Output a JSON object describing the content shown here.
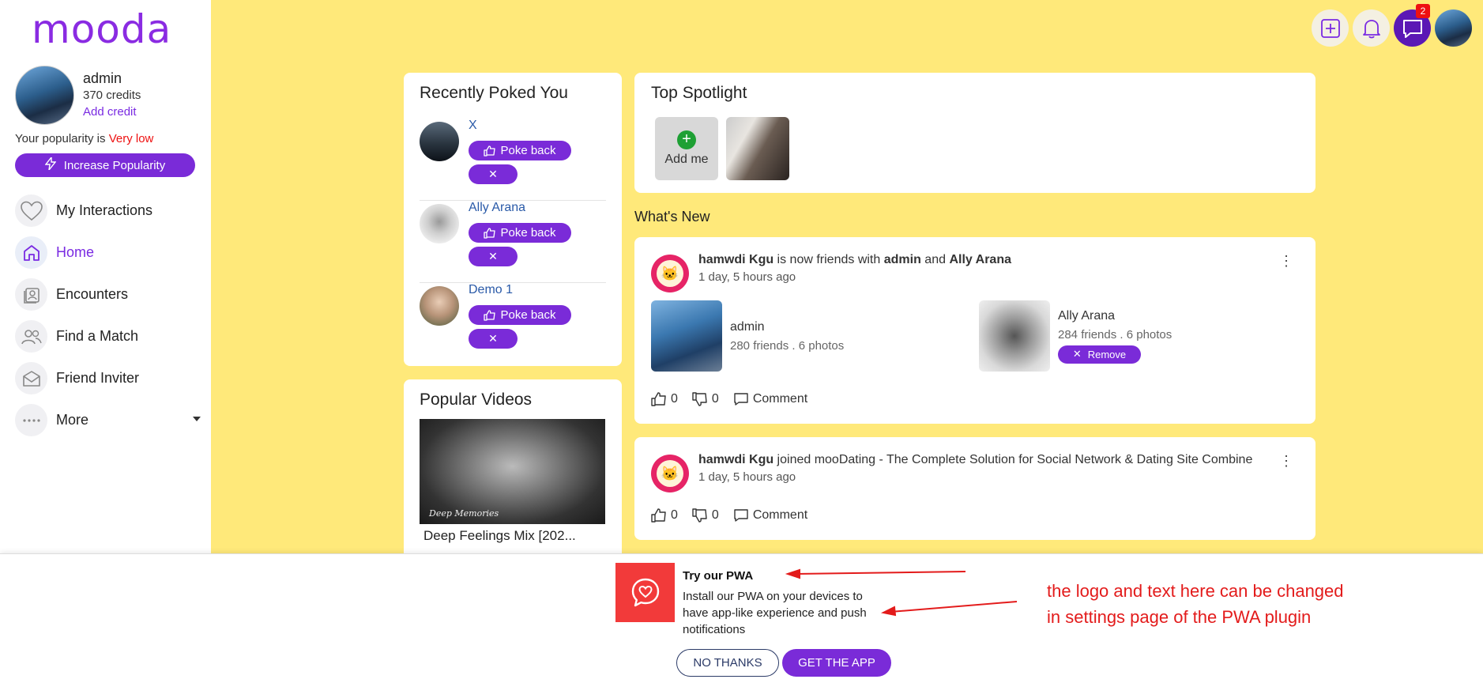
{
  "app": {
    "logo": "mooda"
  },
  "profile": {
    "name": "admin",
    "credits": "370 credits",
    "add_credit": "Add credit",
    "popularity_prefix": "Your popularity is ",
    "popularity_level": "Very low",
    "increase_button": "Increase Popularity"
  },
  "nav": {
    "items": [
      {
        "label": "My Interactions",
        "icon": "heart-icon"
      },
      {
        "label": "Home",
        "icon": "home-icon"
      },
      {
        "label": "Encounters",
        "icon": "encounters-icon"
      },
      {
        "label": "Find a Match",
        "icon": "users-icon"
      },
      {
        "label": "Friend Inviter",
        "icon": "mail-icon"
      },
      {
        "label": "More",
        "icon": "more-icon"
      }
    ]
  },
  "topbar": {
    "notification_count": "2"
  },
  "poked": {
    "title": "Recently Poked You",
    "poke_back_label": "Poke back",
    "items": [
      {
        "name": "X"
      },
      {
        "name": "Ally Arana"
      },
      {
        "name": "Demo 1"
      }
    ]
  },
  "videos": {
    "title": "Popular Videos",
    "video_title": "Deep Feelings Mix [202...",
    "thumb_caption": "Deep Memories"
  },
  "spotlight": {
    "title": "Top Spotlight",
    "add_me": "Add me"
  },
  "whats_new": {
    "title": "What's New"
  },
  "feed": {
    "post1": {
      "actor": "hamwdi Kgu",
      "text1": " is now friends with ",
      "friend1": "admin",
      "text2": " and ",
      "friend2": "Ally Arana",
      "time": "1 day, 5 hours ago",
      "card1": {
        "name": "admin",
        "meta": "280 friends . 6 photos"
      },
      "card2": {
        "name": "Ally Arana",
        "meta": "284 friends . 6 photos",
        "remove": "Remove"
      },
      "likes": "0",
      "dislikes": "0",
      "comment": "Comment"
    },
    "post2": {
      "actor": "hamwdi Kgu",
      "text": " joined mooDating - The Complete Solution for Social Network & Dating Site Combine",
      "time": "1 day, 5 hours ago",
      "likes": "0",
      "dislikes": "0",
      "comment": "Comment"
    }
  },
  "pwa": {
    "title": "Try our PWA",
    "description": "Install our PWA on your devices to have app-like experience and push notifications",
    "no_thanks": "NO THANKS",
    "get_app": "GET THE APP",
    "annotation_line1": "the logo and text here can be changed",
    "annotation_line2": "in settings page of the PWA plugin"
  },
  "colors": {
    "accent": "#7a2bd8",
    "background": "#ffe97a",
    "annotation": "#e31b1b",
    "pwa_logo": "#f23a3a"
  }
}
